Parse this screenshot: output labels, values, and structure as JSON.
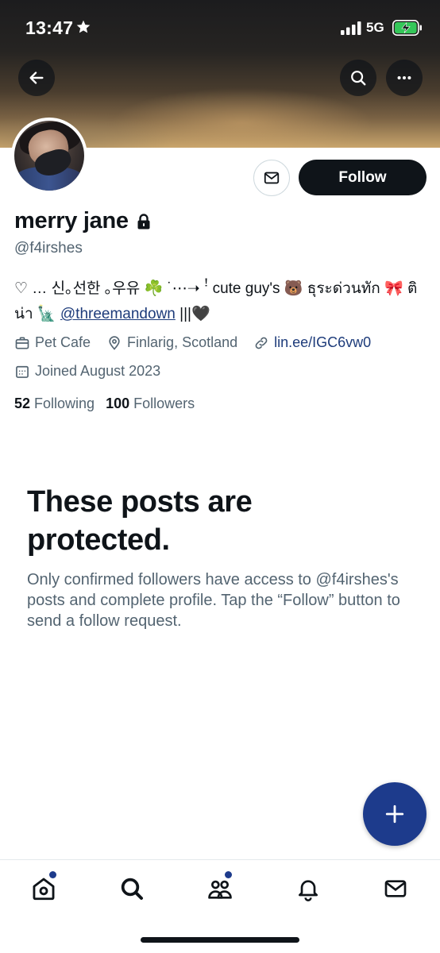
{
  "status_bar": {
    "time": "13:47",
    "network": "5G",
    "battery_color": "#34c759"
  },
  "header": {
    "back_icon": "arrow-left-icon",
    "search_icon": "search-icon",
    "more_icon": "more-horizontal-icon"
  },
  "profile": {
    "name": "merry jane",
    "handle": "@f4irshes",
    "bio_text": "  ♡  …  신｡선한 ｡우유 ☘️ ˙⋯➝       ꜝ cute guy's 🐻 ธุระด่วนทัก 🎀 ติน่า 🗽 ",
    "bio_link": "@threemandown",
    "bio_tail": " |||🖤",
    "category": "Pet Cafe",
    "location": "Finlarig, Scotland",
    "url": "lin.ee/IGC6vw0",
    "joined": "Joined August 2023",
    "following_count": "52",
    "following_label": "Following",
    "followers_count": "100",
    "followers_label": "Followers"
  },
  "actions": {
    "message_icon": "envelope-icon",
    "follow_label": "Follow"
  },
  "protected": {
    "title": "These posts are protected.",
    "body": "Only confirmed followers have access to @f4irshes's posts and complete profile. Tap the “Follow” button to send a follow request."
  },
  "fab": {
    "icon": "plus-icon"
  },
  "tabbar": {
    "items": [
      {
        "icon": "home-icon",
        "has_dot": true
      },
      {
        "icon": "search-icon",
        "has_dot": false
      },
      {
        "icon": "communities-icon",
        "has_dot": true
      },
      {
        "icon": "bell-icon",
        "has_dot": false
      },
      {
        "icon": "envelope-icon",
        "has_dot": false
      }
    ],
    "accent": "#1d3b8c"
  }
}
